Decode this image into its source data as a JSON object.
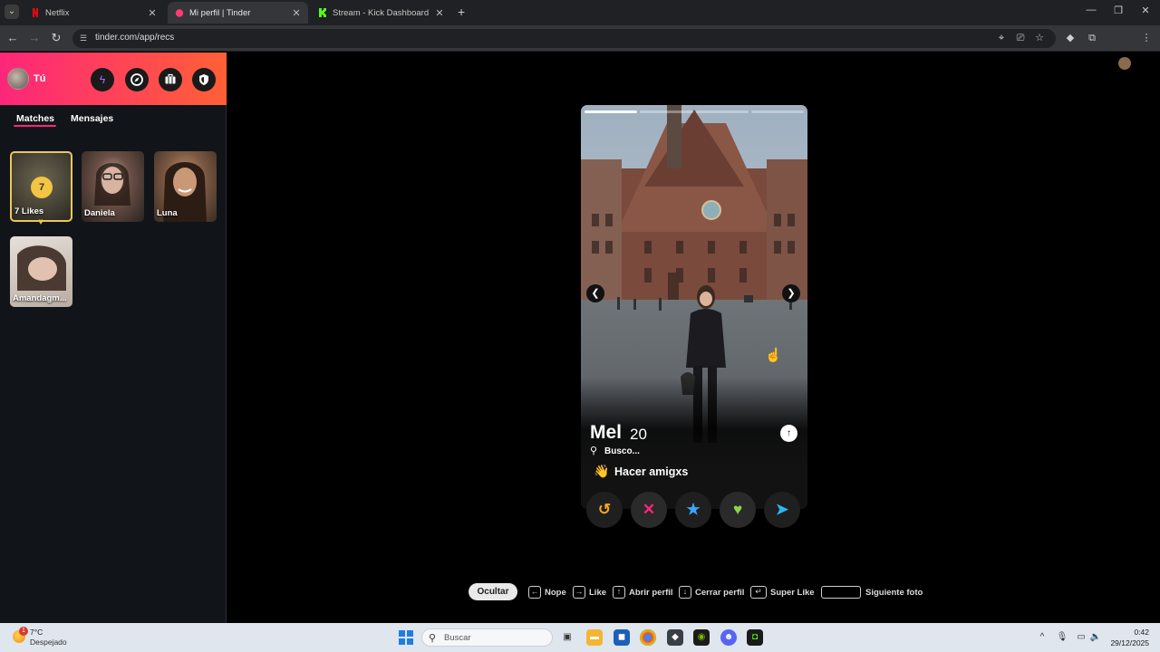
{
  "browser": {
    "tabs": [
      {
        "title": "Netflix",
        "favicon_color": "#e50914",
        "active": false
      },
      {
        "title": "Mi perfil | Tinder",
        "favicon_color": "#fe3c72",
        "active": true
      },
      {
        "title": "Stream - Kick Dashboard",
        "favicon_color": "#53fc18",
        "active": false
      }
    ],
    "url": "tinder.com/app/recs",
    "icons": [
      "back-icon",
      "forward-icon",
      "reload-icon",
      "location-icon",
      "cast-icon",
      "bookmark-star-icon",
      "extension-icon",
      "puzzle-icon",
      "menu-dots-icon"
    ]
  },
  "sidebar": {
    "user_label": "Tú",
    "header_colors": [
      "#fd267a",
      "#ff6036"
    ],
    "header_buttons": [
      "boost-icon",
      "explore-icon",
      "briefcase-icon",
      "shield-icon"
    ],
    "tabs": [
      "Matches",
      "Mensajes"
    ],
    "likes_card": {
      "count": "7",
      "label": "7 Likes"
    },
    "matches": [
      "Daniela",
      "Luna",
      "Amandagm..."
    ]
  },
  "card": {
    "name": "Mel",
    "age": "20",
    "looking_label": "Busco...",
    "goal_emoji": "👋",
    "goal": "Hacer amigxs",
    "photo_count": 4,
    "current_photo": 1
  },
  "actions": [
    {
      "name": "rewind",
      "glyph": "↺",
      "color": "#f5a623"
    },
    {
      "name": "nope",
      "glyph": "✕",
      "color": "#fd267a"
    },
    {
      "name": "super-like",
      "glyph": "★",
      "color": "#3ca4ff"
    },
    {
      "name": "like",
      "glyph": "♥",
      "color": "#8bd846"
    },
    {
      "name": "boost",
      "glyph": "➤",
      "color": "#2ab8f0"
    }
  ],
  "hints": {
    "hide_button": "Ocultar",
    "nope": "Nope",
    "like": "Like",
    "open_profile": "Abrir perfil",
    "close_profile": "Cerrar perfil",
    "super_like": "Super Like",
    "next_photo": "Siguiente foto"
  },
  "taskbar": {
    "weather_temp": "7°C",
    "weather_desc": "Despejado",
    "weather_badge": "1",
    "search_placeholder": "Buscar",
    "time": "0:42",
    "date": "29/12/2025"
  }
}
